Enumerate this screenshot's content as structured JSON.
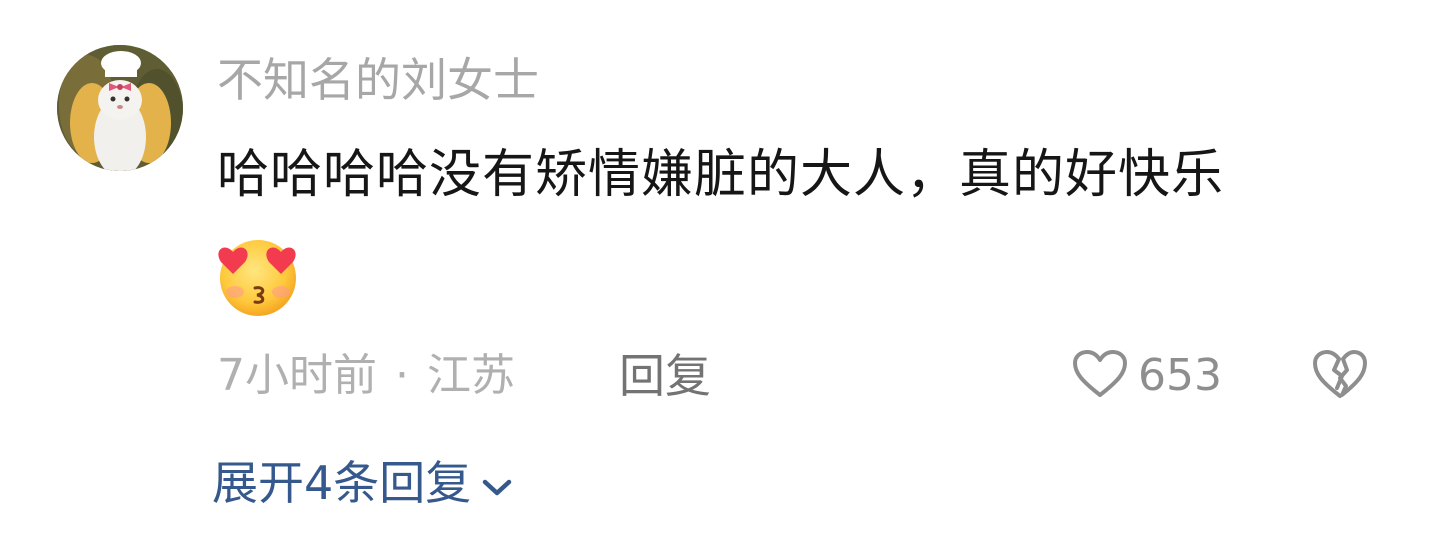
{
  "comment": {
    "username": "不知名的刘女士",
    "text": "哈哈哈哈没有矫情嫌脏的大人，真的好快乐",
    "emoji": "heart-eyes-kiss-emoji",
    "time": "7小时前",
    "separator": "·",
    "location": "江苏",
    "reply_label": "回复",
    "like_icon": "heart-outline-icon",
    "like_count": "653",
    "dislike_icon": "broken-heart-icon",
    "expand_label": "展开4条回复",
    "expand_icon": "chevron-down-icon"
  },
  "colors": {
    "username": "#a7a7a7",
    "text": "#161616",
    "meta": "#b0b0b0",
    "reply": "#737373",
    "icon": "#8e8e8e",
    "link": "#35598c"
  }
}
